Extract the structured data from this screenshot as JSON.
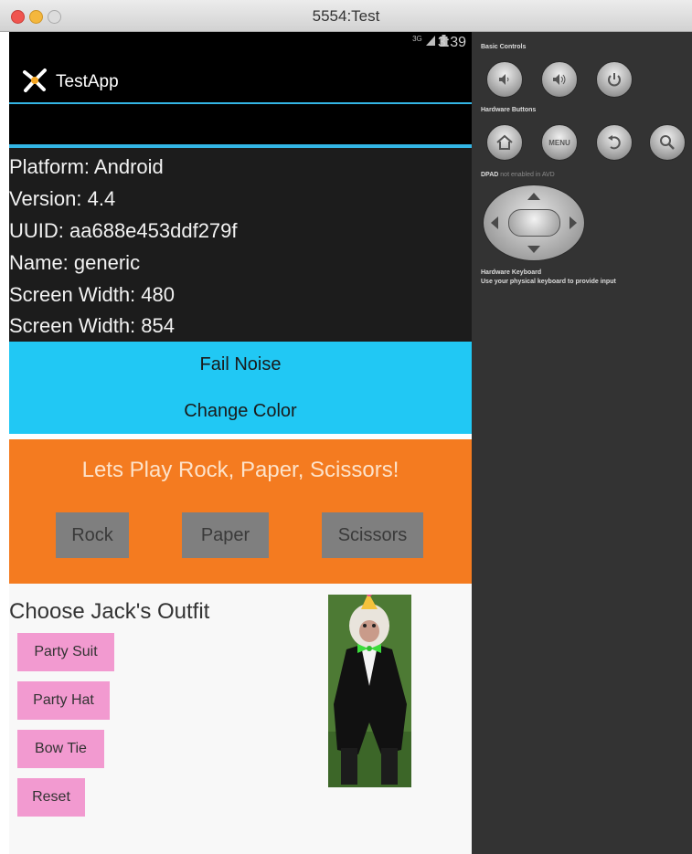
{
  "window": {
    "title": "5554:Test"
  },
  "status_bar": {
    "signal_text": "3G",
    "time": "3:39"
  },
  "app": {
    "title": "TestApp"
  },
  "device_info": [
    "Platform: Android",
    "Version: 4.4",
    "UUID: aa688e453ddf279f",
    "Name: generic",
    "Screen Width: 480",
    "Screen Width: 854"
  ],
  "actions": {
    "fail_noise": "Fail Noise",
    "change_color": "Change Color"
  },
  "game": {
    "title": "Lets Play Rock, Paper, Scissors!",
    "rock": "Rock",
    "paper": "Paper",
    "scissors": "Scissors"
  },
  "outfit": {
    "title": "Choose Jack's Outfit",
    "party_suit": "Party Suit",
    "party_hat": "Party Hat",
    "bow_tie": "Bow Tie",
    "reset": "Reset"
  },
  "emulator_panel": {
    "basic_controls": "Basic Controls",
    "hardware_buttons": "Hardware Buttons",
    "menu_label": "MENU",
    "dpad_label": "DPAD",
    "dpad_note": "not enabled in AVD",
    "keyboard_title": "Hardware Keyboard",
    "keyboard_note": "Use your physical keyboard to provide input"
  },
  "colors": {
    "accent_blue": "#33b5e5",
    "cyan_panel": "#21c8f4",
    "orange_panel": "#f47b20",
    "pink_button": "#f29ad0",
    "emulator_panel": "#333333"
  },
  "icons": [
    "app-logo-icon",
    "signal-icon",
    "battery-icon",
    "volume-down-icon",
    "volume-up-icon",
    "power-icon",
    "home-icon",
    "back-icon",
    "search-icon",
    "dpad-icon"
  ]
}
